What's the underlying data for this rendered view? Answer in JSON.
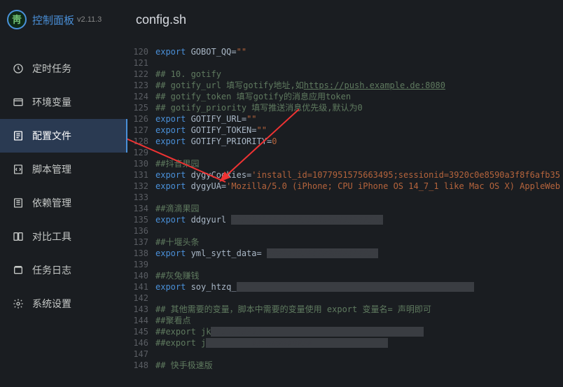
{
  "app": {
    "title": "控制面板",
    "version": "v2.11.3",
    "logo_glyph": "靑"
  },
  "sidebar": {
    "items": [
      {
        "label": "定时任务",
        "icon": "clock-icon"
      },
      {
        "label": "环境变量",
        "icon": "env-icon"
      },
      {
        "label": "配置文件",
        "icon": "config-icon"
      },
      {
        "label": "脚本管理",
        "icon": "script-icon"
      },
      {
        "label": "依赖管理",
        "icon": "dep-icon"
      },
      {
        "label": "对比工具",
        "icon": "diff-icon"
      },
      {
        "label": "任务日志",
        "icon": "log-icon"
      },
      {
        "label": "系统设置",
        "icon": "gear-icon"
      }
    ],
    "activeIndex": 2
  },
  "page": {
    "title": "config.sh"
  },
  "editor": {
    "startLine": 120,
    "lines": [
      {
        "n": 120,
        "tokens": [
          [
            "kw",
            "export"
          ],
          [
            "var",
            " GOBOT_QQ="
          ],
          [
            "str",
            "\"\""
          ]
        ]
      },
      {
        "n": 121,
        "tokens": []
      },
      {
        "n": 122,
        "tokens": [
          [
            "cmt",
            "## 10. gotify"
          ]
        ]
      },
      {
        "n": 123,
        "tokens": [
          [
            "cmt",
            "## gotify_url 填写gotify地址,如"
          ],
          [
            "link",
            "https://push.example.de:8080"
          ]
        ]
      },
      {
        "n": 124,
        "tokens": [
          [
            "cmt",
            "## gotify_token 填写gotify的消息应用token"
          ]
        ]
      },
      {
        "n": 125,
        "tokens": [
          [
            "cmt",
            "## gotify_priority 填写推送消息优先级,默认为0"
          ]
        ]
      },
      {
        "n": 126,
        "tokens": [
          [
            "kw",
            "export"
          ],
          [
            "var",
            " GOTIFY_URL="
          ],
          [
            "str",
            "\"\""
          ]
        ]
      },
      {
        "n": 127,
        "tokens": [
          [
            "kw",
            "export"
          ],
          [
            "var",
            " GOTIFY_TOKEN="
          ],
          [
            "str",
            "\"\""
          ]
        ]
      },
      {
        "n": 128,
        "tokens": [
          [
            "kw",
            "export"
          ],
          [
            "var",
            " GOTIFY_PRIORITY="
          ],
          [
            "str",
            "0"
          ]
        ]
      },
      {
        "n": 129,
        "tokens": []
      },
      {
        "n": 130,
        "tokens": [
          [
            "cmt",
            "##抖音果园"
          ]
        ]
      },
      {
        "n": 131,
        "tokens": [
          [
            "kw",
            "export"
          ],
          [
            "var",
            " dygyCookies="
          ],
          [
            "str",
            "'install_id=1077951575663495;sessionid=3920c0e8590a3f8f6afb35"
          ]
        ]
      },
      {
        "n": 132,
        "tokens": [
          [
            "kw",
            "export"
          ],
          [
            "var",
            " dygyUA="
          ],
          [
            "str",
            "'Mozilla/5.0 (iPhone; CPU iPhone OS 14_7_1 like Mac OS X) AppleWeb"
          ]
        ]
      },
      {
        "n": 133,
        "tokens": []
      },
      {
        "n": 134,
        "tokens": [
          [
            "cmt",
            "##滴滴果园"
          ]
        ]
      },
      {
        "n": 135,
        "tokens": [
          [
            "kw",
            "export"
          ],
          [
            "var",
            " ddgyurl "
          ],
          [
            "hl",
            "##############################"
          ]
        ]
      },
      {
        "n": 136,
        "tokens": []
      },
      {
        "n": 137,
        "tokens": [
          [
            "cmt",
            "##十堰头条"
          ]
        ]
      },
      {
        "n": 138,
        "tokens": [
          [
            "kw",
            "export"
          ],
          [
            "var",
            " yml_sytt_data= "
          ],
          [
            "hl",
            "######################"
          ]
        ]
      },
      {
        "n": 139,
        "tokens": []
      },
      {
        "n": 140,
        "tokens": [
          [
            "cmt",
            "##灰兔赚钱"
          ]
        ]
      },
      {
        "n": 141,
        "tokens": [
          [
            "kw",
            "export"
          ],
          [
            "var",
            " soy_htzq_"
          ],
          [
            "hl",
            "                                               "
          ]
        ]
      },
      {
        "n": 142,
        "tokens": []
      },
      {
        "n": 143,
        "tokens": [
          [
            "cmt",
            "## 其他需要的变量，脚本中需要的变量使用 export 变量名= 声明即可"
          ]
        ]
      },
      {
        "n": 144,
        "tokens": [
          [
            "cmt",
            "##聚看点"
          ]
        ]
      },
      {
        "n": 145,
        "tokens": [
          [
            "cmt",
            "##export jk"
          ],
          [
            "hl",
            "##########                                "
          ]
        ]
      },
      {
        "n": 146,
        "tokens": [
          [
            "cmt",
            "##export j"
          ],
          [
            "hl",
            "         ############               "
          ]
        ]
      },
      {
        "n": 147,
        "tokens": []
      },
      {
        "n": 148,
        "tokens": [
          [
            "cmt",
            "## 快手极速版"
          ]
        ]
      }
    ]
  }
}
